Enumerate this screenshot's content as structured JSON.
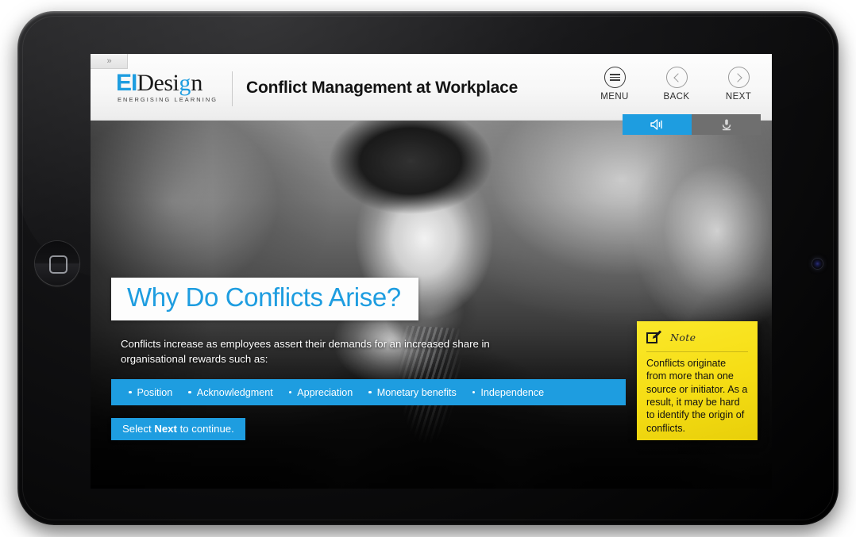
{
  "device": {
    "home_button": "home-button",
    "camera": "front-camera"
  },
  "expand_button": {
    "glyph": "»",
    "name": "expand-sidebar-button"
  },
  "header": {
    "logo": {
      "part_ei": "EI",
      "part_design": "Desi",
      "part_g": "g",
      "part_n": "n",
      "tagline": "ENERGISING LEARNING"
    },
    "course_title": "Conflict Management at Workplace",
    "nav": [
      {
        "label": "MENU",
        "icon": "hamburger-menu-icon"
      },
      {
        "label": "BACK",
        "icon": "chevron-left-icon"
      },
      {
        "label": "NEXT",
        "icon": "chevron-right-icon"
      }
    ],
    "media_buttons": [
      {
        "name": "audio-toggle-button",
        "icon": "speaker-volume-icon",
        "color": "#1e9de0",
        "state": "active"
      },
      {
        "name": "transcript-button",
        "icon": "microphone-icon",
        "color": "#6f6f6f",
        "state": "inactive"
      }
    ]
  },
  "slide": {
    "heading": "Why Do Conflicts Arise?",
    "body": "Conflicts increase as employees assert their demands for an increased share in organisational rewards such as:",
    "bullets": [
      "Position",
      "Acknowledgment",
      "Appreciation",
      "Monetary benefits",
      "Independence"
    ],
    "continue_prefix": "Select ",
    "continue_bold": "Next",
    "continue_suffix": " to continue.",
    "photo_alt": "Black and white photograph of a businessman in a suit looking downward"
  },
  "note": {
    "icon": "edit-note-icon",
    "title": "Note",
    "body": "Conflicts originate from more than one source or initiator. As a result, it may be hard to identify the origin of conflicts."
  },
  "colors": {
    "accent_blue": "#1e9de0",
    "note_yellow": "#f5dd14",
    "header_bg": "#f7f7f7",
    "inactive_gray": "#6f6f6f"
  }
}
